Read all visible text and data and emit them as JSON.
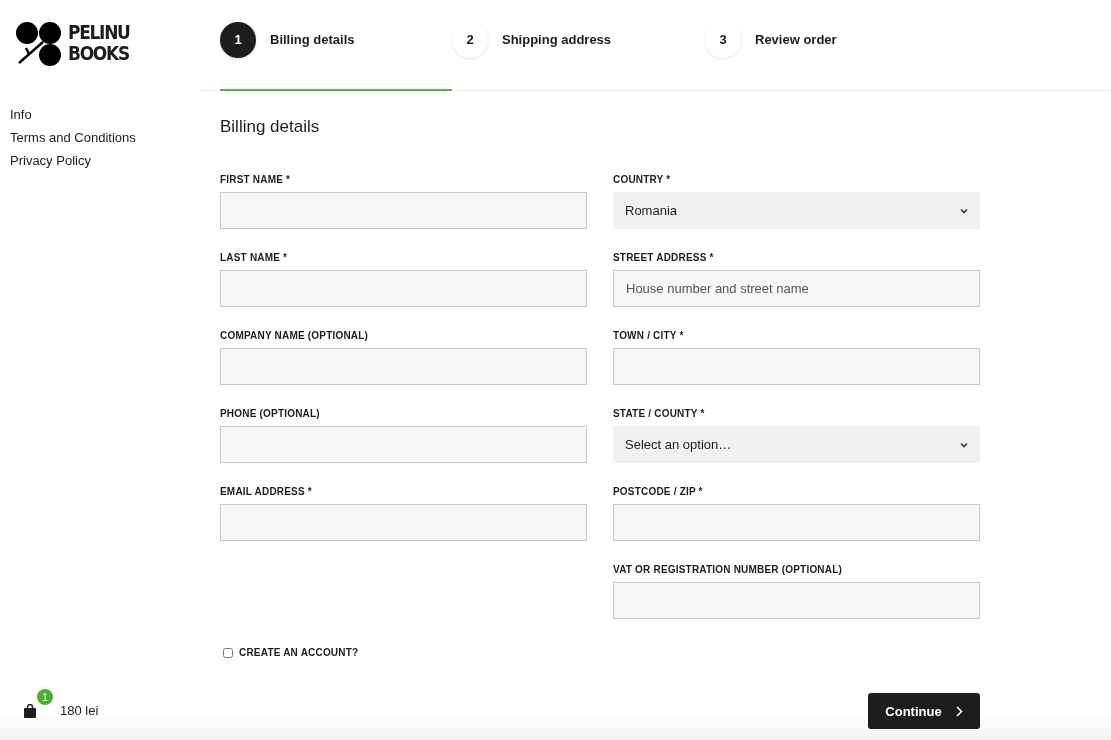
{
  "logo": {
    "line_1": "PELINU",
    "line_2": "BOOKS"
  },
  "sidebar": {
    "links": [
      "Info",
      "Terms and Conditions",
      "Privacy Policy"
    ]
  },
  "steps": [
    {
      "number": "1",
      "label": "Billing details",
      "selected": true
    },
    {
      "number": "2",
      "label": "Shipping address",
      "selected": false
    },
    {
      "number": "3",
      "label": "Review order",
      "selected": false
    }
  ],
  "form": {
    "title": "Billing details",
    "left_fields": [
      {
        "label": "FIRST NAME *",
        "kind": "text"
      },
      {
        "label": "LAST NAME *",
        "kind": "text"
      },
      {
        "label": "COMPANY NAME (OPTIONAL)",
        "kind": "text"
      },
      {
        "label": "PHONE (OPTIONAL)",
        "kind": "text"
      },
      {
        "label": "EMAIL ADDRESS *",
        "kind": "text"
      }
    ],
    "right_fields": [
      {
        "label": "COUNTRY *",
        "kind": "select",
        "value": "Romania"
      },
      {
        "label": "STREET ADDRESS *",
        "kind": "text",
        "placeholder": "House number and street name"
      },
      {
        "label": "TOWN / CITY *",
        "kind": "text"
      },
      {
        "label": "STATE / COUNTY *",
        "kind": "select",
        "value": "Select an option…"
      },
      {
        "label": "POSTCODE / ZIP *",
        "kind": "text"
      },
      {
        "label": "VAT OR REGISTRATION NUMBER (OPTIONAL)",
        "kind": "text"
      }
    ],
    "create_account": {
      "label": "CREATE AN ACCOUNT?",
      "checked": false
    },
    "continue_button": "Continue"
  },
  "cart": {
    "count": "1",
    "total": "180 lei"
  }
}
